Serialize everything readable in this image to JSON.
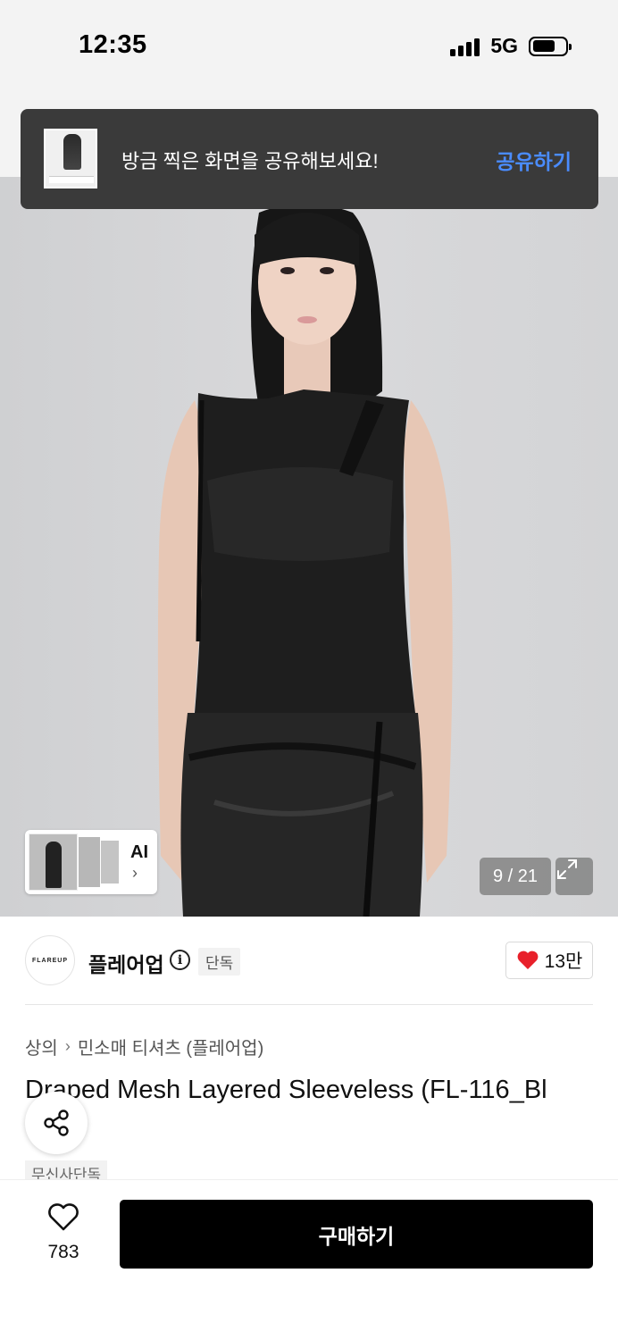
{
  "status_bar": {
    "time": "12:35",
    "network": "5G"
  },
  "toast": {
    "message": "방금 찍은 화면을 공유해보세요!",
    "action": "공유하기"
  },
  "gallery": {
    "counter": "9 / 21",
    "ai_label": "AI",
    "current_index": 9,
    "total": 21
  },
  "brand": {
    "logo_text": "FLAREUP",
    "name": "플레어업",
    "exclusive_badge": "단독",
    "likes": "13만"
  },
  "breadcrumb": {
    "category": "상의",
    "subcategory": "민소매 티셔츠 (플레어업)"
  },
  "product": {
    "title": "Draped Mesh Layered Sleeveless (FL-116_Bl",
    "tag": "무신사단독"
  },
  "bottom": {
    "wish_count": "783",
    "buy_label": "구매하기"
  },
  "colors": {
    "accent_blue": "#4a8cff",
    "like_red": "#e8202a",
    "buy_bg": "#000000"
  },
  "icons": {
    "info": "info-icon",
    "heart": "heart-icon",
    "share": "share-icon",
    "expand": "expand-icon",
    "chevron": "chevron-right-icon"
  }
}
